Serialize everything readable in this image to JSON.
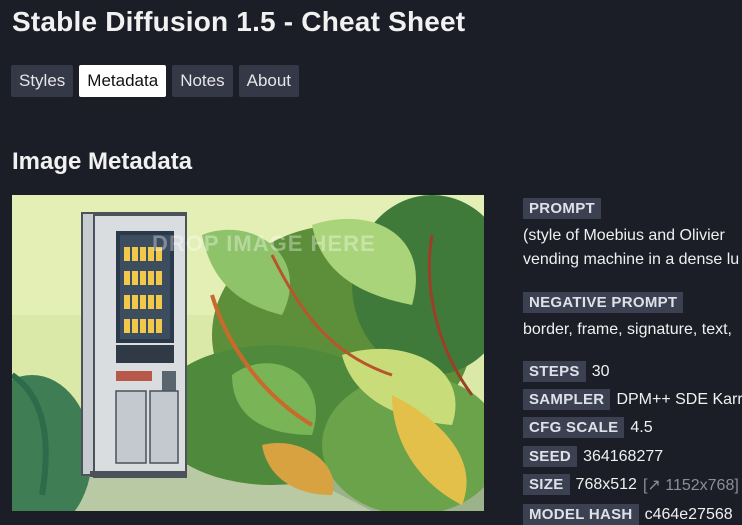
{
  "app": {
    "title": "Stable Diffusion 1.5 - Cheat Sheet"
  },
  "tabs": [
    {
      "label": "Styles"
    },
    {
      "label": "Metadata"
    },
    {
      "label": "Notes"
    },
    {
      "label": "About"
    }
  ],
  "section": {
    "title": "Image Metadata"
  },
  "image": {
    "overlay_text": "DROP IMAGE HERE"
  },
  "metadata": {
    "prompt_label": "PROMPT",
    "prompt_line1": "(style of Moebius and Olivier",
    "prompt_line2": "vending machine in a dense lu",
    "negative_label": "NEGATIVE PROMPT",
    "negative_text": "border, frame, signature, text,",
    "steps_label": "STEPS",
    "steps_value": "30",
    "sampler_label": "SAMPLER",
    "sampler_value": "DPM++ SDE Karras",
    "cfg_label": "CFG SCALE",
    "cfg_value": "4.5",
    "seed_label": "SEED",
    "seed_value": "364168277",
    "size_label": "SIZE",
    "size_value": "768x512",
    "size_upscale": "[↗ 1152x768]",
    "hash_label": "MODEL HASH",
    "hash_value": "c464e27568"
  }
}
